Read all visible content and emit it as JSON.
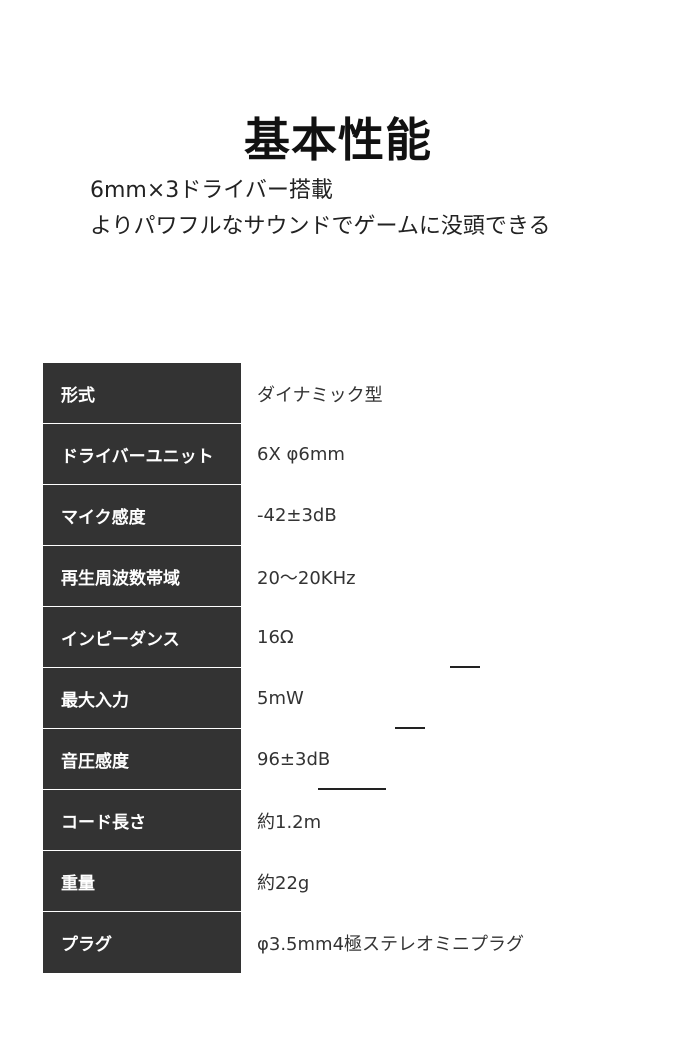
{
  "title": "基本性能",
  "subtitle_lines": [
    "6mm×3ドライバー搭載",
    "よりパワフルなサウンドでゲームに没頭できる"
  ],
  "specs": [
    {
      "label": "形式",
      "value": "ダイナミック型"
    },
    {
      "label": "ドライバーユニット",
      "value": "6X φ6mm"
    },
    {
      "label": "マイク感度",
      "value": "-42±3dB"
    },
    {
      "label": "再生周波数帯域",
      "value": "20～20KHz"
    },
    {
      "label": "インピーダンス",
      "value": "16Ω"
    },
    {
      "label": "最大入力",
      "value": "5mW"
    },
    {
      "label": "音圧感度",
      "value": "96±3dB"
    },
    {
      "label": "コード長さ",
      "value": "約1.2m"
    },
    {
      "label": "重量",
      "value": "約22g"
    },
    {
      "label": "プラグ",
      "value": "φ3.5mm4極ステレオミニプラグ"
    }
  ]
}
